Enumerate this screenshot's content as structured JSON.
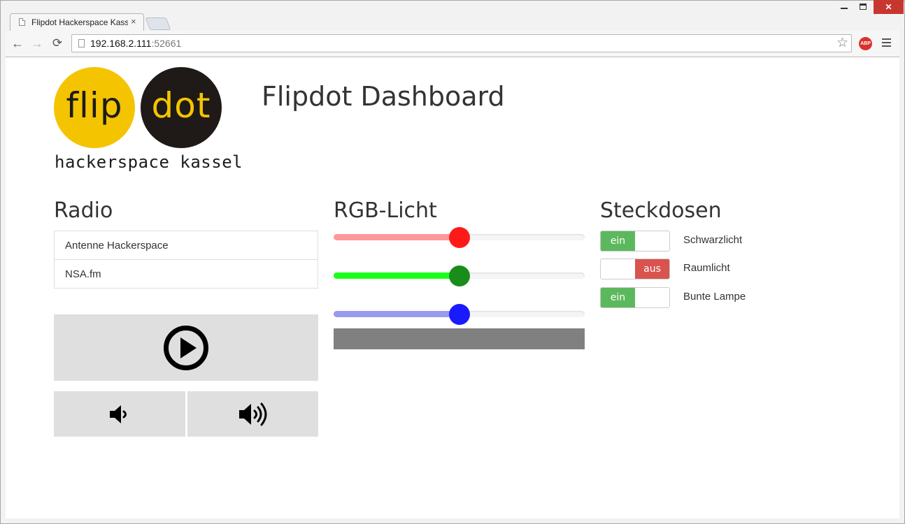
{
  "browser": {
    "tab_title": "Flipdot Hackerspace Kassel",
    "tab_close_glyph": "×",
    "window_close_glyph": "✕",
    "url_host": "192.168.2.111",
    "url_port": ":52661",
    "star_glyph": "☆",
    "abp_label": "ABP",
    "back_glyph": "←",
    "forward_glyph": "→",
    "reload_glyph": "⟳"
  },
  "logo": {
    "flip": "flip",
    "dot": "dot",
    "subtitle": "hackerspace kassel",
    "colors": {
      "yellow": "#f5c400",
      "dark": "#1f1a17"
    }
  },
  "header": {
    "title": "Flipdot Dashboard"
  },
  "radio": {
    "title": "Radio",
    "stations": [
      {
        "label": "Antenne Hackerspace"
      },
      {
        "label": "NSA.fm"
      }
    ],
    "play_icon": "play-circle-icon",
    "volume_down_icon": "volume-down-icon",
    "volume_up_icon": "volume-up-icon"
  },
  "rgb": {
    "title": "RGB-Licht",
    "channels": [
      {
        "name": "red",
        "level": 0.5,
        "fill_color": "#ff9999",
        "thumb_color": "#ff1a1a"
      },
      {
        "name": "green",
        "level": 0.5,
        "fill_color": "#1aff1a",
        "thumb_color": "#1a8c1a"
      },
      {
        "name": "blue",
        "level": 0.5,
        "fill_color": "#9999ee",
        "thumb_color": "#1a1aff"
      }
    ],
    "preview_color": "#808080"
  },
  "sockets": {
    "title": "Steckdosen",
    "on_color": "#5cb85c",
    "off_color": "#d9534f",
    "items": [
      {
        "label": "Schwarzlicht",
        "state": "on",
        "state_label": "ein"
      },
      {
        "label": "Raumlicht",
        "state": "off",
        "state_label": "aus"
      },
      {
        "label": "Bunte Lampe",
        "state": "on",
        "state_label": "ein"
      }
    ]
  }
}
